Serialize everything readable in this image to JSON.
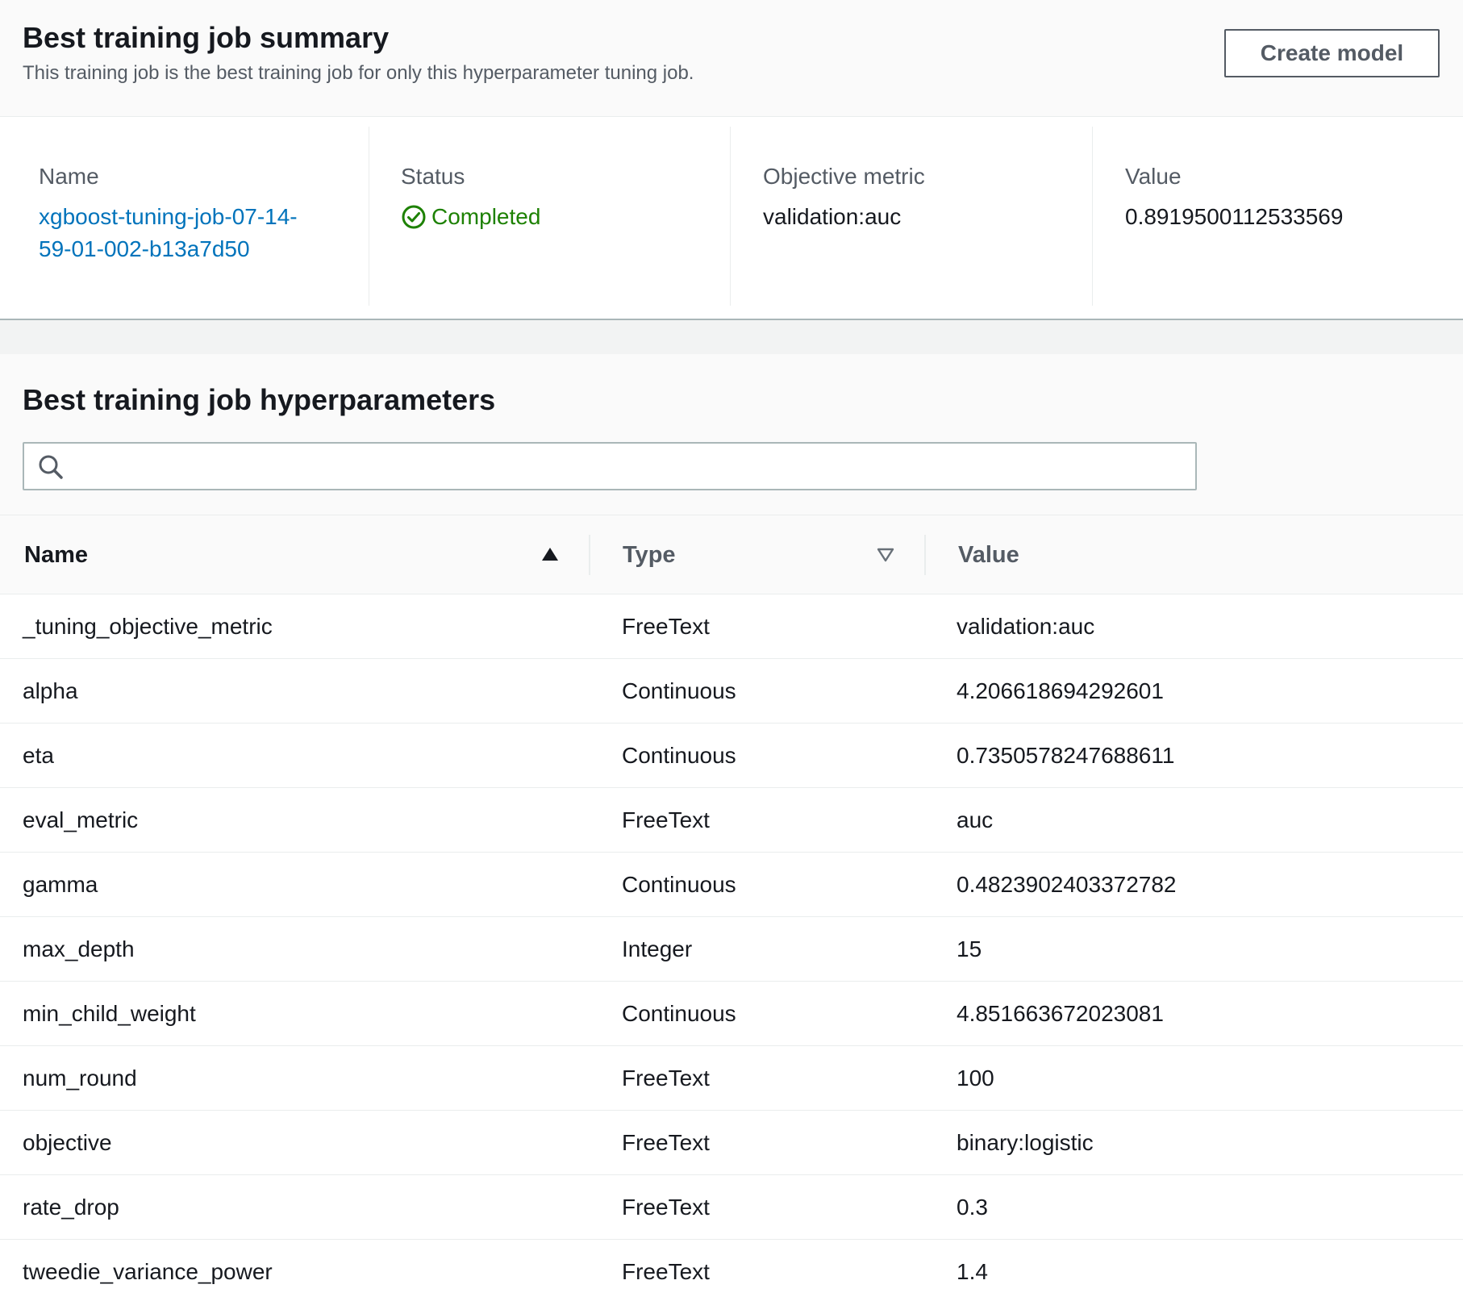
{
  "summary": {
    "title": "Best training job summary",
    "description": "This training job is the best training job for only this hyperparameter tuning job.",
    "create_button": "Create model",
    "name_label": "Name",
    "name_value_line1": "xgboost-tuning-job-07-14-",
    "name_value_line2": "59-01-002-b13a7d50",
    "status_label": "Status",
    "status_value": "Completed",
    "metric_label": "Objective metric",
    "metric_value": "validation:auc",
    "value_label": "Value",
    "value_value": "0.8919500112533569"
  },
  "hyperparameters": {
    "title": "Best training job hyperparameters",
    "search_placeholder": "",
    "columns": {
      "name": "Name",
      "type": "Type",
      "value": "Value"
    },
    "rows": [
      {
        "name": "_tuning_objective_metric",
        "type": "FreeText",
        "value": "validation:auc"
      },
      {
        "name": "alpha",
        "type": "Continuous",
        "value": "4.206618694292601"
      },
      {
        "name": "eta",
        "type": "Continuous",
        "value": "0.7350578247688611"
      },
      {
        "name": "eval_metric",
        "type": "FreeText",
        "value": "auc"
      },
      {
        "name": "gamma",
        "type": "Continuous",
        "value": "0.4823902403372782"
      },
      {
        "name": "max_depth",
        "type": "Integer",
        "value": "15"
      },
      {
        "name": "min_child_weight",
        "type": "Continuous",
        "value": "4.851663672023081"
      },
      {
        "name": "num_round",
        "type": "FreeText",
        "value": "100"
      },
      {
        "name": "objective",
        "type": "FreeText",
        "value": "binary:logistic"
      },
      {
        "name": "rate_drop",
        "type": "FreeText",
        "value": "0.3"
      },
      {
        "name": "tweedie_variance_power",
        "type": "FreeText",
        "value": "1.4"
      }
    ]
  },
  "colors": {
    "link": "#0073bb",
    "success": "#1d8102",
    "border": "#aab7b8"
  }
}
